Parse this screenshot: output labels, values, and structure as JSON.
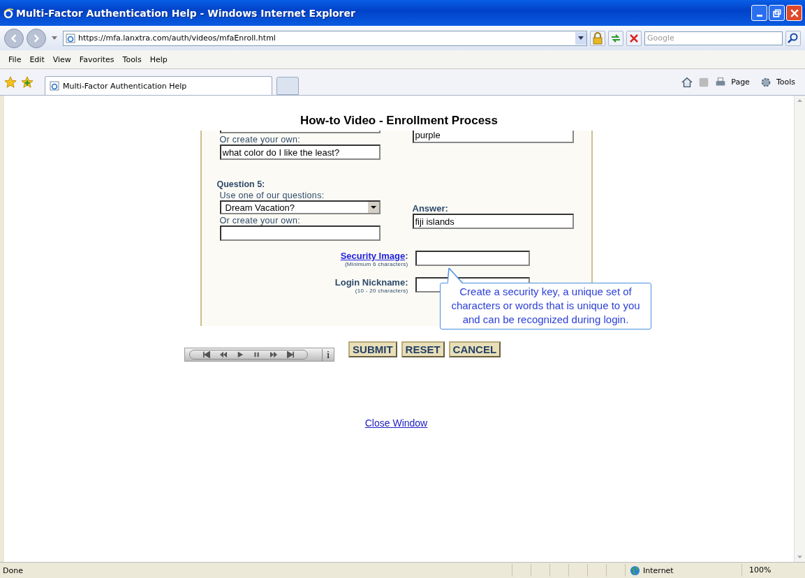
{
  "window": {
    "title": "Multi-Factor Authentication Help - Windows Internet Explorer"
  },
  "address_bar": {
    "url": "https://mfa.lanxtra.com/auth/videos/mfaEnroll.html"
  },
  "search": {
    "placeholder": "Google"
  },
  "menu": [
    "File",
    "Edit",
    "View",
    "Favorites",
    "Tools",
    "Help"
  ],
  "tab": {
    "label": "Multi-Factor Authentication Help"
  },
  "command_bar": [
    "Page",
    "Tools"
  ],
  "page": {
    "heading": "How-to Video - Enrollment Process",
    "partial_answer": "purple",
    "q4_custom_label": "Or create your own:",
    "q4_custom_value": "what color do I like the least?",
    "q5": {
      "label": "Question 5:",
      "use_label": "Use one of our questions:",
      "selected": "Dream Vacation?",
      "custom_label": "Or create your own:",
      "answer_label": "Answer:",
      "answer_value": "fiji islands"
    },
    "fields": [
      {
        "kind": "link",
        "label": "Security Image",
        "suffix": ":",
        "hint": "(Minimum 6 characters)"
      },
      {
        "kind": "plain",
        "label": "Login Nickname:",
        "hint": "(10 - 20 characters)"
      }
    ],
    "tooltip": "Create a security key, a unique set of characters or words that is unique to you and can be recognized during login.",
    "player_info": "i",
    "buttons": [
      "SUBMIT",
      "RESET",
      "CANCEL"
    ],
    "close_link": "Close Window"
  },
  "status_bar": {
    "text": "Done",
    "zone": "Internet",
    "zoom": "100%"
  }
}
